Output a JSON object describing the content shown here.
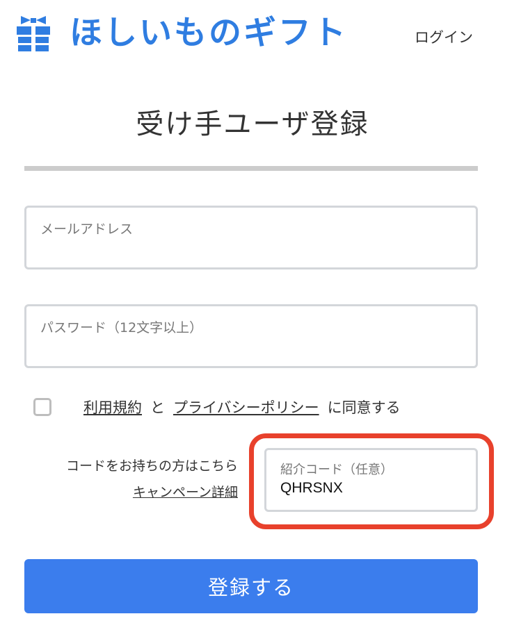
{
  "header": {
    "logo_text": "ほしいものギフト",
    "logo_icon": "gift-box-icon",
    "login_label": "ログイン"
  },
  "page_title": "受け手ユーザ登録",
  "form": {
    "email": {
      "label": "メールアドレス",
      "value": ""
    },
    "password": {
      "label": "パスワード（12文字以上）",
      "value": ""
    },
    "agreement": {
      "checked": false,
      "terms_link": "利用規約",
      "and_text": "と",
      "privacy_link": "プライバシーポリシー",
      "suffix_text": "に同意する"
    },
    "referral": {
      "note": "コードをお持ちの方はこちら",
      "campaign_link": "キャンペーン詳細",
      "label": "紹介コード（任意）",
      "value": "QHRSNX"
    },
    "submit_label": "登録する"
  },
  "colors": {
    "brand_blue": "#2f7de1",
    "button_blue": "#3b7ded",
    "highlight_red": "#e8412c",
    "rule_gray": "#cccccc"
  }
}
